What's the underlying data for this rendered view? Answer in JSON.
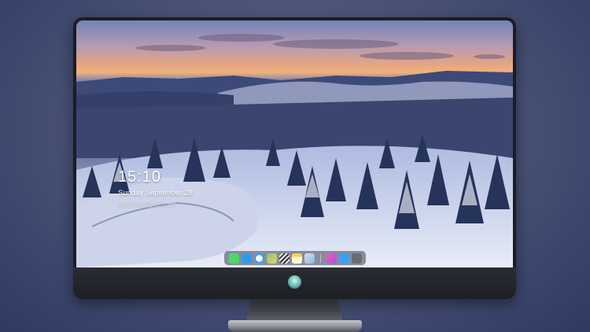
{
  "lockscreen": {
    "time": "15:10",
    "date": "Sunday September 28",
    "status_lines": [
      "Windows 10 Desktop · Airline Lockscreen · Calendar · ",
      "Battery 89% · Wi-Fi Connected · Weather Forecast"
    ]
  },
  "dock": {
    "items": [
      {
        "icon": "messages-icon",
        "color": "#4cd964"
      },
      {
        "icon": "finder-icon",
        "color": "#2f9bf0"
      },
      {
        "icon": "safari-icon",
        "color": "#f4f4f4"
      },
      {
        "icon": "maps-icon",
        "color": "#8cc56a"
      },
      {
        "icon": "clapper-icon",
        "color": "#3a3a3a"
      },
      {
        "icon": "notes-icon",
        "color": "#f7d34a"
      },
      {
        "icon": "photos-icon",
        "color": "#d7dde8"
      },
      {
        "icon": "music-icon",
        "color": "#f05fb5"
      },
      {
        "icon": "appstore-icon",
        "color": "#3aa0f5"
      },
      {
        "icon": "camera-icon",
        "color": "#6a6c72"
      }
    ]
  },
  "monitor": {
    "logo": "monitor-brand-logo"
  }
}
